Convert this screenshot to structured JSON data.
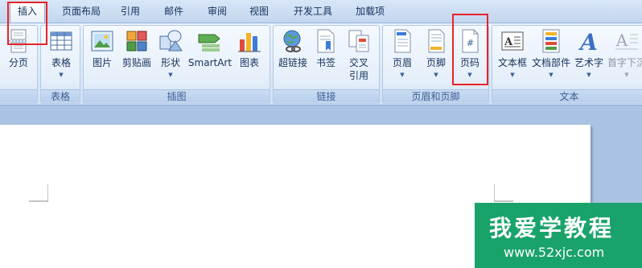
{
  "tabs": [
    "插入",
    "页面布局",
    "引用",
    "邮件",
    "审阅",
    "视图",
    "开发工具",
    "加载项"
  ],
  "groups": {
    "pages": "",
    "table": "表格",
    "illustrations": "插图",
    "links": "链接",
    "header_footer": "页眉和页脚",
    "text": "文本"
  },
  "buttons": {
    "page_break": "分页",
    "table": "表格",
    "picture": "图片",
    "clip_art": "剪贴画",
    "shapes": "形状",
    "smartart": "SmartArt",
    "chart": "图表",
    "hyperlink": "超链接",
    "bookmark": "书签",
    "cross_ref_1": "交叉",
    "cross_ref_2": "引用",
    "header": "页眉",
    "footer": "页脚",
    "page_number": "页码",
    "text_box": "文本框",
    "quick_parts": "文档部件",
    "wordart": "艺术字",
    "drop_cap": "首字下沉"
  },
  "watermark": {
    "title": "我爱学教程",
    "url": "www.52xjc.com"
  },
  "colors": {
    "highlight": "#e8232a",
    "watermark_bg": "#19a36b"
  }
}
